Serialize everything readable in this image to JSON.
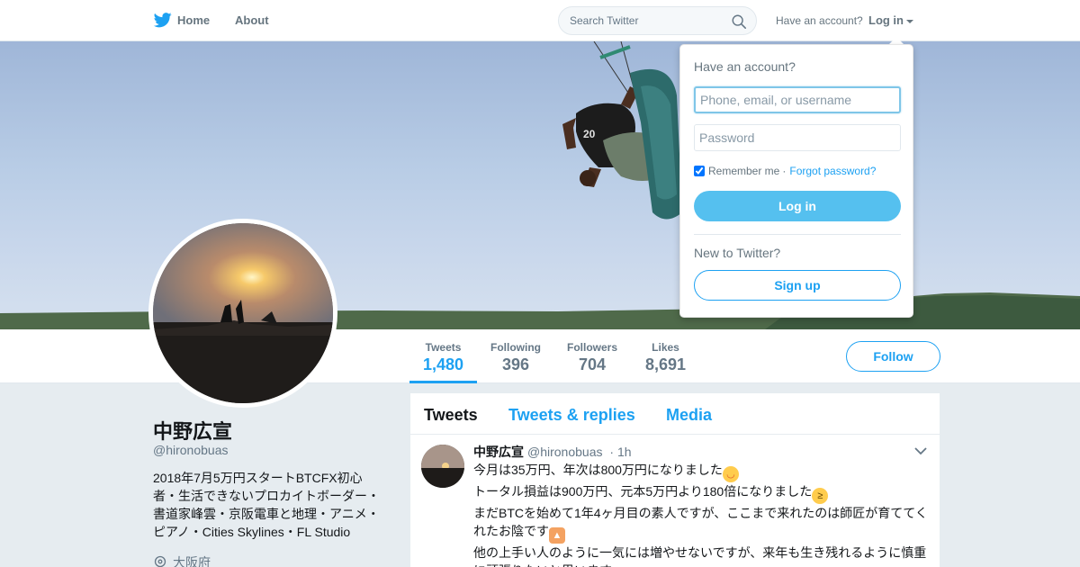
{
  "nav": {
    "home_label": "Home",
    "about_label": "About",
    "search_placeholder": "Search Twitter",
    "have_account": "Have an account?",
    "login_label": "Log in"
  },
  "profile": {
    "name": "中野広宣",
    "handle": "@hironobuas",
    "bio": "2018年7月5万円スタートBTCFX初心者・生活できないプロカイトボーダー・書道家峰雲・京阪電車と地理・アニメ・ピアノ・Cities Skylines・FL Studio",
    "location": "大阪府"
  },
  "stats": [
    {
      "label": "Tweets",
      "value": "1,480",
      "active": true
    },
    {
      "label": "Following",
      "value": "396",
      "active": false
    },
    {
      "label": "Followers",
      "value": "704",
      "active": false
    },
    {
      "label": "Likes",
      "value": "8,691",
      "active": false
    }
  ],
  "follow_label": "Follow",
  "timeline": {
    "tabs": [
      "Tweets",
      "Tweets & replies",
      "Media"
    ],
    "tweet": {
      "name": "中野広宣",
      "handle": "@hironobuas",
      "time": "1h",
      "lines": [
        "今月は35万円、年次は800万円になりました",
        "トータル損益は900万円、元本5万円より180倍になりました",
        "まだBTCを始めて1年4ヶ月目の素人ですが、ここまで来れたのは師匠が育ててくれたお陰です",
        "他の上手い人のように一気には増やせないですが、来年も生き残れるように慎重に頑張りたいと思います"
      ]
    }
  },
  "login_dropdown": {
    "title": "Have an account?",
    "username_placeholder": "Phone, email, or username",
    "password_placeholder": "Password",
    "remember_label": "Remember me",
    "forgot_label": "Forgot password?",
    "login_button": "Log in",
    "new_label": "New to Twitter?",
    "signup_button": "Sign up"
  },
  "colors": {
    "accent": "#1da1f2",
    "login_button_bg": "#55c0ef",
    "page_bg": "#e6ecf0"
  }
}
